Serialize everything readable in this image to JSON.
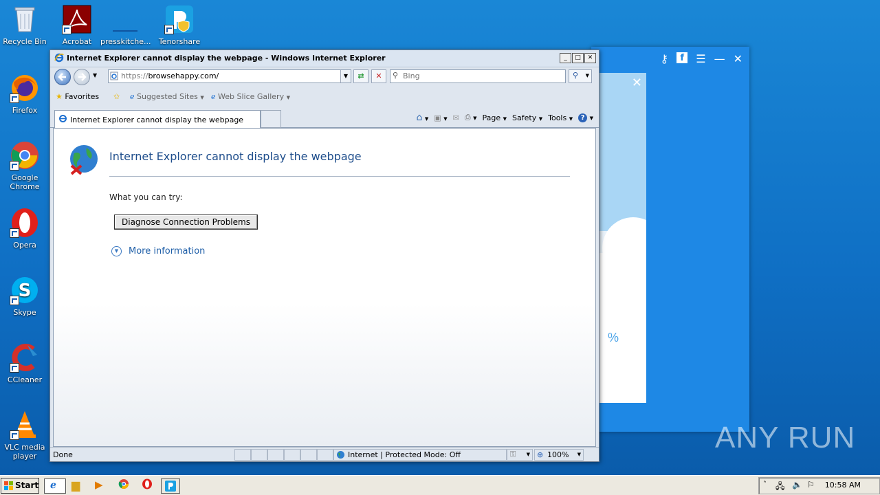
{
  "desktop": {
    "icons": [
      {
        "label": "Recycle Bin"
      },
      {
        "label": "Acrobat"
      },
      {
        "label": "presskitche..."
      },
      {
        "label": "Tenorshare"
      },
      {
        "label": "Firefox"
      },
      {
        "label": "Google Chrome"
      },
      {
        "label": "Opera"
      },
      {
        "label": "Skype"
      },
      {
        "label": "CCleaner"
      },
      {
        "label": "VLC media player"
      }
    ]
  },
  "background_app": {
    "percent_fragment": "%",
    "icons": [
      "key-icon",
      "facebook-icon",
      "menu-icon",
      "minimize-icon",
      "close-icon"
    ]
  },
  "ie": {
    "window_title": "Internet Explorer cannot display the webpage - Windows Internet Explorer",
    "address": {
      "scheme": "https://",
      "host": "browsehappy.com/"
    },
    "search_placeholder": "Bing",
    "favorites": {
      "label": "Favorites",
      "suggested": "Suggested Sites",
      "webslice": "Web Slice Gallery"
    },
    "tab_label": "Internet Explorer cannot display the webpage",
    "commands": {
      "page": "Page",
      "safety": "Safety",
      "tools": "Tools"
    },
    "content": {
      "title": "Internet Explorer cannot display the webpage",
      "try_text": "What you can try:",
      "diagnose_button": "Diagnose Connection Problems",
      "more_info": "More information"
    },
    "status": {
      "left": "Done",
      "zone": "Internet | Protected Mode: Off",
      "zoom": "100%"
    }
  },
  "taskbar": {
    "start": "Start",
    "clock": "10:58 AM"
  },
  "watermark": "ANY RUN"
}
